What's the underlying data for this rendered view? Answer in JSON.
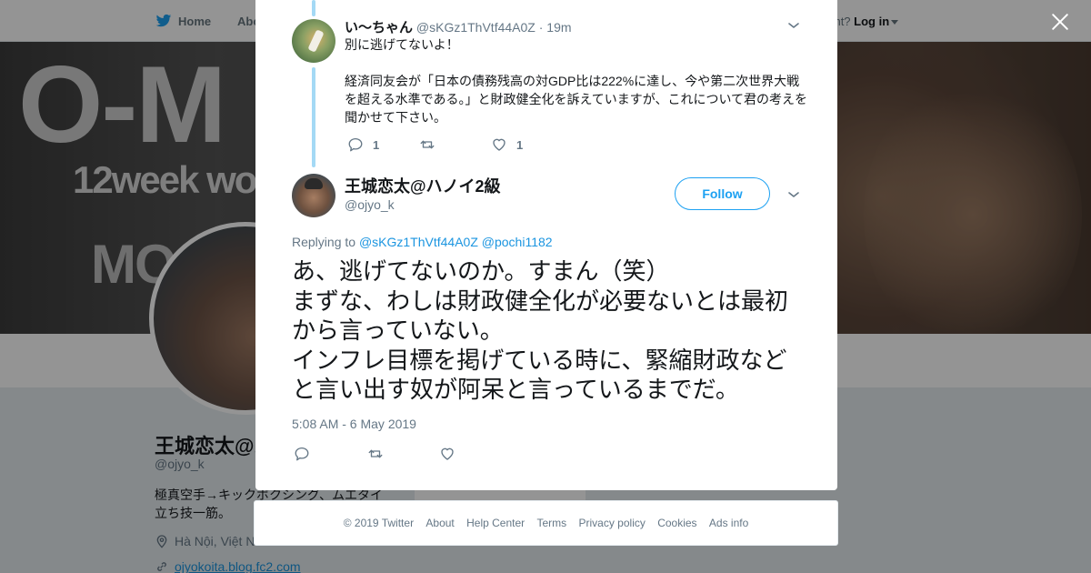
{
  "background": {
    "nav": {
      "home": "Home",
      "about": "Abo",
      "account_prompt": "ccount?",
      "login": "Log in"
    },
    "banner_text": {
      "line1": "O-M",
      "line2": "12week wo",
      "line3": "MO"
    },
    "profile": {
      "name": "王城恋太@ハ",
      "handle": "@ojyo_k",
      "bio": "極真空手→キックボクシング、ムエタイ 立ち技一筋。",
      "location": "Hà Nội, Việt N",
      "url": "ojyokoita.blog.fc2.com"
    },
    "side_card_text": "Ads info"
  },
  "modal": {
    "parent_tweet": {
      "name": "い〜ちゃん",
      "handle": "@sKGz1ThVtf44A0Z",
      "separator": "·",
      "time": "19m",
      "text_line1": "別に逃げてないよ！",
      "text_line2": "経済同友会が「日本の債務残高の対GDP比は222%に達し、今や第二次世界大戦を超える水準である。」と財政健全化を訴えていますが、これについて君の考えを聞かせて下さい。",
      "reply_count": "1",
      "retweet_count": "",
      "like_count": "1"
    },
    "main_tweet": {
      "name": "王城恋太@ハノイ2級",
      "handle": "@ojyo_k",
      "follow_label": "Follow",
      "replying_prefix": "Replying to",
      "replying_to_1": "@sKGz1ThVtf44A0Z",
      "replying_to_2": "@pochi1182",
      "text_line1": "あ、逃げてないのか。すまん（笑）",
      "text_line2": "まずな、わしは財政健全化が必要ないとは最初から言っていない。",
      "text_line3": "インフレ目標を掲げている時に、緊縮財政などと言い出す奴が阿呆と言っているまでだ。",
      "timestamp": "5:08 AM - 6 May 2019"
    },
    "footer_links": [
      "© 2019 Twitter",
      "About",
      "Help Center",
      "Terms",
      "Privacy policy",
      "Cookies",
      "Ads info"
    ]
  },
  "colors": {
    "accent": "#1da1f2",
    "link": "#1b95e0",
    "muted_text": "#657786",
    "thread_line": "#a4d9f5",
    "overlay": "rgba(0,0,0,0.42)"
  },
  "icons": [
    "twitter-bird-icon",
    "close-icon",
    "chevron-down-icon",
    "reply-icon",
    "retweet-icon",
    "like-icon",
    "location-icon",
    "link-icon"
  ]
}
